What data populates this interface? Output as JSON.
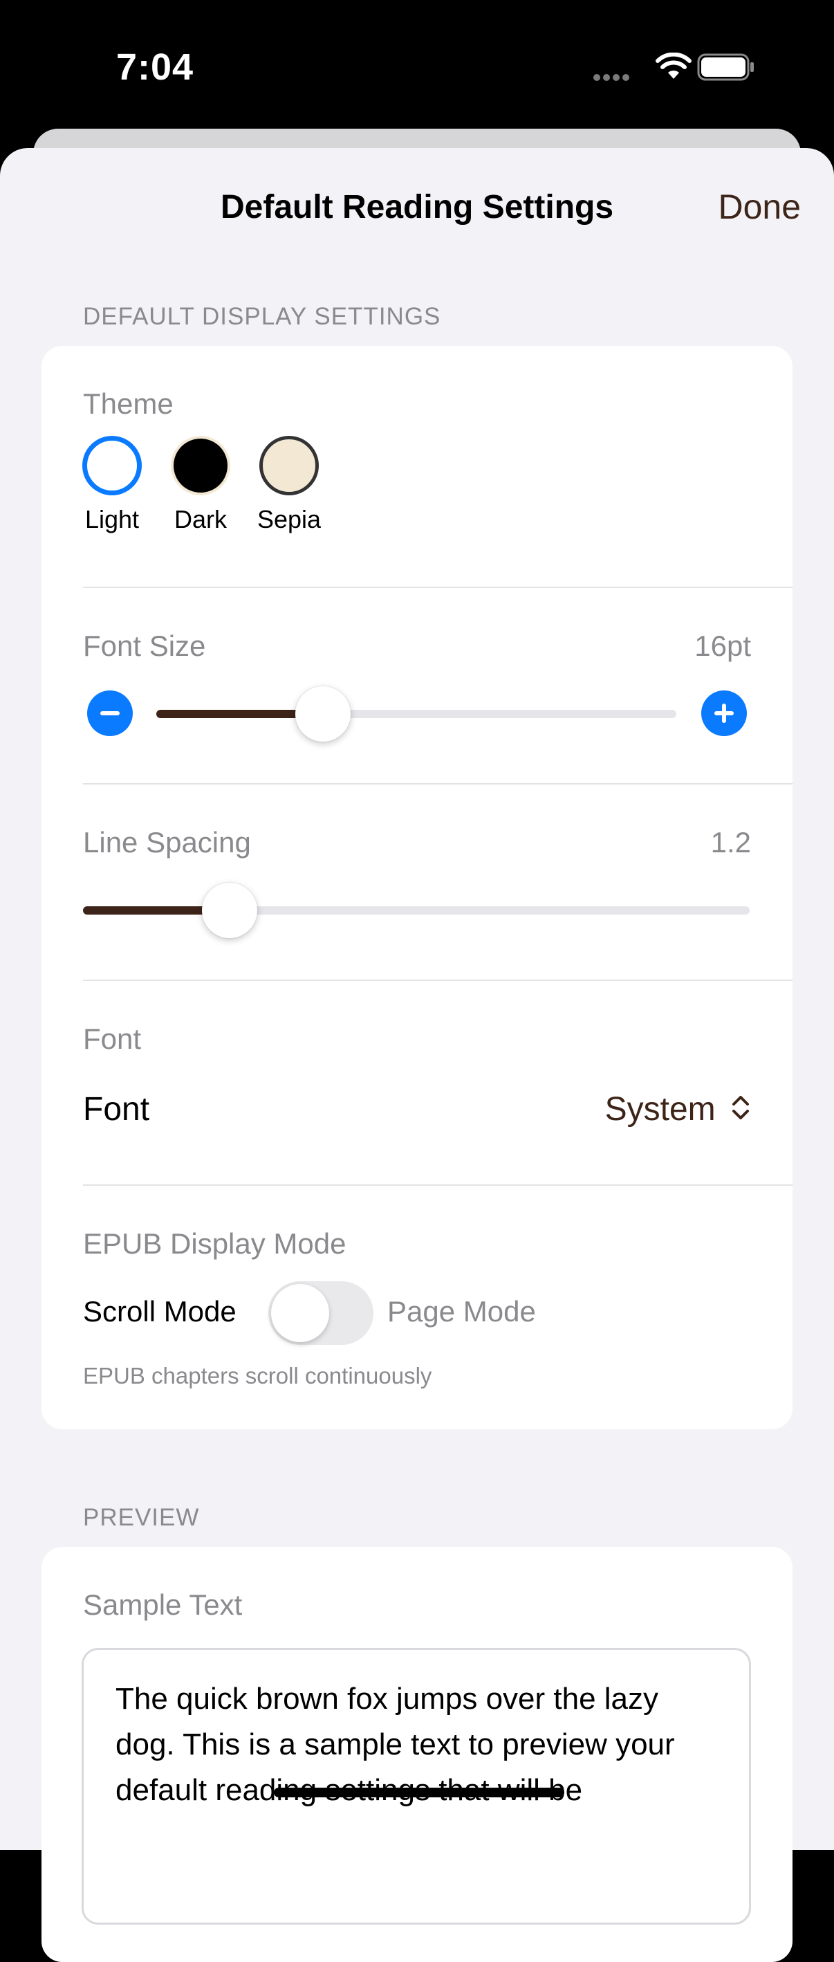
{
  "status_bar": {
    "time": "7:04"
  },
  "nav": {
    "title": "Default Reading Settings",
    "done_label": "Done"
  },
  "display_section": {
    "header": "DEFAULT DISPLAY SETTINGS",
    "theme": {
      "label": "Theme",
      "selected": "Light",
      "options": [
        {
          "label": "Light",
          "fill": "#ffffff",
          "border": "#0a7bff"
        },
        {
          "label": "Dark",
          "fill": "#000000",
          "border": "#f2e8d4"
        },
        {
          "label": "Sepia",
          "fill": "#f2e8d4",
          "border": "#333333"
        }
      ]
    },
    "font_size": {
      "label": "Font Size",
      "value_text": "16pt",
      "fraction": 0.32
    },
    "line_spacing": {
      "label": "Line Spacing",
      "value_text": "1.2",
      "fraction": 0.22
    },
    "font": {
      "label": "Font",
      "row_label": "Font",
      "value": "System"
    },
    "epub_mode": {
      "label": "EPUB Display Mode",
      "left_label": "Scroll Mode",
      "right_label": "Page Mode",
      "toggle_on": false,
      "note": "EPUB chapters scroll continuously"
    }
  },
  "preview_section": {
    "header": "PREVIEW",
    "label": "Sample Text",
    "text": "The quick brown fox jumps over the lazy dog. This is a sample text to preview your default reading settings that will be"
  },
  "colors": {
    "accent": "#0a7bff",
    "brand_brown": "#3d2418",
    "secondary_text": "#8a8a8e"
  },
  "icons": [
    "signal-icon",
    "wifi-icon",
    "battery-icon",
    "minus-icon",
    "plus-icon",
    "chevron-updown-icon"
  ]
}
